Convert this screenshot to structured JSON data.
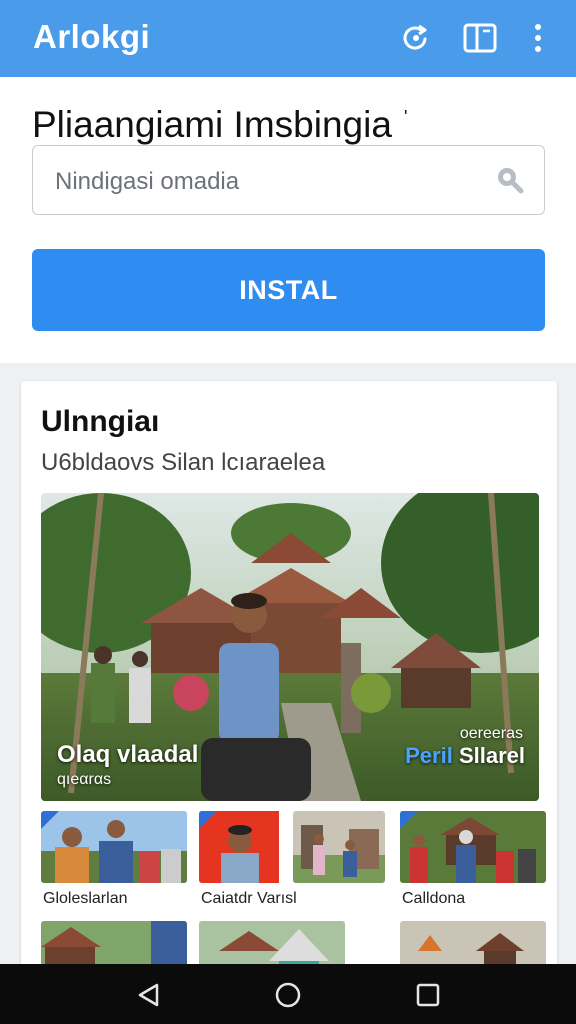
{
  "appbar": {
    "title": "Arlokgi",
    "icons": [
      "refresh-icon",
      "book-icon",
      "more-vert-icon"
    ],
    "color": "#4a9bea"
  },
  "header": {
    "title": "Pliaangiami Imsbingia",
    "title_mark": "'"
  },
  "search": {
    "placeholder": "Nindigasi omadia"
  },
  "install": {
    "label": "INSTAL",
    "color": "#2f8cf0"
  },
  "card": {
    "heading": "Ulnngiaı",
    "subtitle": "U6bldaovs Silan lcıaraelea",
    "hero": {
      "caption_left_title": "Olaq vlaadal",
      "caption_left_sub": "qıeαrαs",
      "caption_right_top": "oereeras",
      "caption_right_accent": "Peril",
      "caption_right_rest": "Sllarel"
    },
    "thumbnails": [
      {
        "label": "Gloleslarlan"
      },
      {
        "label": "Caiatdr Varısl"
      },
      {
        "label": ""
      },
      {
        "label": "Calldona"
      }
    ]
  },
  "navbar": {
    "buttons": [
      "back-icon",
      "home-icon",
      "recents-icon"
    ]
  }
}
